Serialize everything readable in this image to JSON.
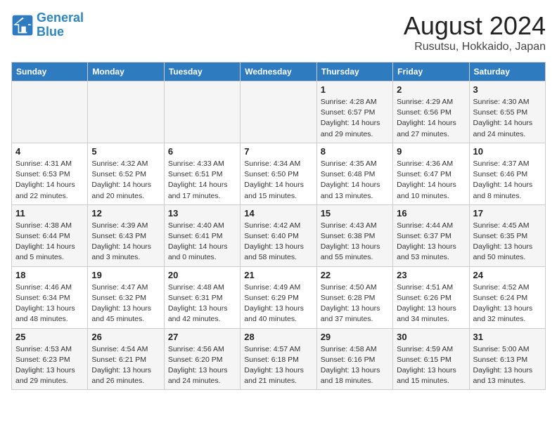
{
  "logo": {
    "line1": "General",
    "line2": "Blue"
  },
  "title": "August 2024",
  "subtitle": "Rusutsu, Hokkaido, Japan",
  "weekdays": [
    "Sunday",
    "Monday",
    "Tuesday",
    "Wednesday",
    "Thursday",
    "Friday",
    "Saturday"
  ],
  "weeks": [
    [
      {
        "day": "",
        "info": ""
      },
      {
        "day": "",
        "info": ""
      },
      {
        "day": "",
        "info": ""
      },
      {
        "day": "",
        "info": ""
      },
      {
        "day": "1",
        "info": "Sunrise: 4:28 AM\nSunset: 6:57 PM\nDaylight: 14 hours\nand 29 minutes."
      },
      {
        "day": "2",
        "info": "Sunrise: 4:29 AM\nSunset: 6:56 PM\nDaylight: 14 hours\nand 27 minutes."
      },
      {
        "day": "3",
        "info": "Sunrise: 4:30 AM\nSunset: 6:55 PM\nDaylight: 14 hours\nand 24 minutes."
      }
    ],
    [
      {
        "day": "4",
        "info": "Sunrise: 4:31 AM\nSunset: 6:53 PM\nDaylight: 14 hours\nand 22 minutes."
      },
      {
        "day": "5",
        "info": "Sunrise: 4:32 AM\nSunset: 6:52 PM\nDaylight: 14 hours\nand 20 minutes."
      },
      {
        "day": "6",
        "info": "Sunrise: 4:33 AM\nSunset: 6:51 PM\nDaylight: 14 hours\nand 17 minutes."
      },
      {
        "day": "7",
        "info": "Sunrise: 4:34 AM\nSunset: 6:50 PM\nDaylight: 14 hours\nand 15 minutes."
      },
      {
        "day": "8",
        "info": "Sunrise: 4:35 AM\nSunset: 6:48 PM\nDaylight: 14 hours\nand 13 minutes."
      },
      {
        "day": "9",
        "info": "Sunrise: 4:36 AM\nSunset: 6:47 PM\nDaylight: 14 hours\nand 10 minutes."
      },
      {
        "day": "10",
        "info": "Sunrise: 4:37 AM\nSunset: 6:46 PM\nDaylight: 14 hours\nand 8 minutes."
      }
    ],
    [
      {
        "day": "11",
        "info": "Sunrise: 4:38 AM\nSunset: 6:44 PM\nDaylight: 14 hours\nand 5 minutes."
      },
      {
        "day": "12",
        "info": "Sunrise: 4:39 AM\nSunset: 6:43 PM\nDaylight: 14 hours\nand 3 minutes."
      },
      {
        "day": "13",
        "info": "Sunrise: 4:40 AM\nSunset: 6:41 PM\nDaylight: 14 hours\nand 0 minutes."
      },
      {
        "day": "14",
        "info": "Sunrise: 4:42 AM\nSunset: 6:40 PM\nDaylight: 13 hours\nand 58 minutes."
      },
      {
        "day": "15",
        "info": "Sunrise: 4:43 AM\nSunset: 6:38 PM\nDaylight: 13 hours\nand 55 minutes."
      },
      {
        "day": "16",
        "info": "Sunrise: 4:44 AM\nSunset: 6:37 PM\nDaylight: 13 hours\nand 53 minutes."
      },
      {
        "day": "17",
        "info": "Sunrise: 4:45 AM\nSunset: 6:35 PM\nDaylight: 13 hours\nand 50 minutes."
      }
    ],
    [
      {
        "day": "18",
        "info": "Sunrise: 4:46 AM\nSunset: 6:34 PM\nDaylight: 13 hours\nand 48 minutes."
      },
      {
        "day": "19",
        "info": "Sunrise: 4:47 AM\nSunset: 6:32 PM\nDaylight: 13 hours\nand 45 minutes."
      },
      {
        "day": "20",
        "info": "Sunrise: 4:48 AM\nSunset: 6:31 PM\nDaylight: 13 hours\nand 42 minutes."
      },
      {
        "day": "21",
        "info": "Sunrise: 4:49 AM\nSunset: 6:29 PM\nDaylight: 13 hours\nand 40 minutes."
      },
      {
        "day": "22",
        "info": "Sunrise: 4:50 AM\nSunset: 6:28 PM\nDaylight: 13 hours\nand 37 minutes."
      },
      {
        "day": "23",
        "info": "Sunrise: 4:51 AM\nSunset: 6:26 PM\nDaylight: 13 hours\nand 34 minutes."
      },
      {
        "day": "24",
        "info": "Sunrise: 4:52 AM\nSunset: 6:24 PM\nDaylight: 13 hours\nand 32 minutes."
      }
    ],
    [
      {
        "day": "25",
        "info": "Sunrise: 4:53 AM\nSunset: 6:23 PM\nDaylight: 13 hours\nand 29 minutes."
      },
      {
        "day": "26",
        "info": "Sunrise: 4:54 AM\nSunset: 6:21 PM\nDaylight: 13 hours\nand 26 minutes."
      },
      {
        "day": "27",
        "info": "Sunrise: 4:56 AM\nSunset: 6:20 PM\nDaylight: 13 hours\nand 24 minutes."
      },
      {
        "day": "28",
        "info": "Sunrise: 4:57 AM\nSunset: 6:18 PM\nDaylight: 13 hours\nand 21 minutes."
      },
      {
        "day": "29",
        "info": "Sunrise: 4:58 AM\nSunset: 6:16 PM\nDaylight: 13 hours\nand 18 minutes."
      },
      {
        "day": "30",
        "info": "Sunrise: 4:59 AM\nSunset: 6:15 PM\nDaylight: 13 hours\nand 15 minutes."
      },
      {
        "day": "31",
        "info": "Sunrise: 5:00 AM\nSunset: 6:13 PM\nDaylight: 13 hours\nand 13 minutes."
      }
    ]
  ]
}
